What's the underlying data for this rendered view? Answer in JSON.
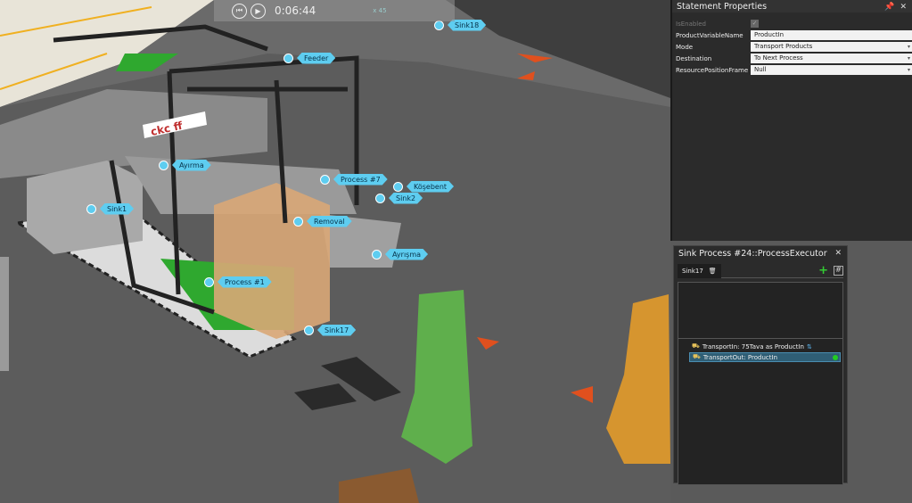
{
  "player": {
    "time": "0:06:44",
    "speed": "x 45"
  },
  "scene_labels": [
    "Sink18",
    "Feeder",
    "Ayırma",
    "Process #7",
    "Köşebent",
    "Sink2",
    "Sink1",
    "Removal",
    "Ayrışma",
    "Process #1",
    "Sink17"
  ],
  "statement_properties": {
    "title": "Statement Properties",
    "rows": [
      {
        "key": "IsEnabled",
        "value": "checked"
      },
      {
        "key": "ProductVariableName",
        "value": "ProductIn"
      },
      {
        "key": "Mode",
        "value": "Transport Products"
      },
      {
        "key": "Destination",
        "value": "To Next Process"
      },
      {
        "key": "ResourcePositionFrame",
        "value": "Null"
      }
    ]
  },
  "sink_process": {
    "title": "Sink Process #24::ProcessExecutor",
    "tab": "Sink17",
    "statements": [
      "TransportIn: 75Tava as ProductIn",
      "TransportOut: ProductIn"
    ],
    "selected_index": 1
  },
  "colors": {
    "label": "#5ecdf0",
    "panel": "#2b2b2b",
    "selection": "#2f5e75",
    "pallet_green": "#2fa82f",
    "box": "#d9a777"
  }
}
